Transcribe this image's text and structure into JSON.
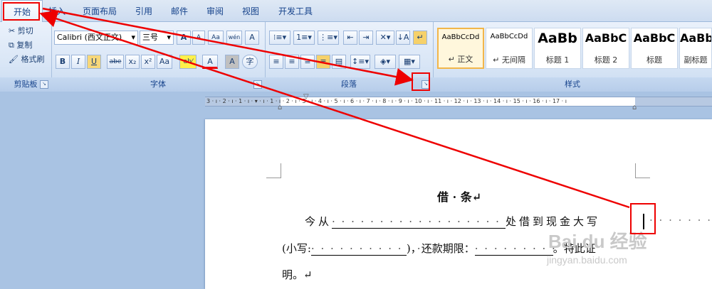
{
  "tabs": [
    "开始",
    "插入",
    "页面布局",
    "引用",
    "邮件",
    "审阅",
    "视图",
    "开发工具"
  ],
  "clipboard": {
    "cut": "剪切",
    "copy": "复制",
    "format_painter": "格式刷",
    "group_label": "剪贴板"
  },
  "font": {
    "name": "Calibri (西文正文)",
    "size": "三号",
    "grow": "A",
    "shrink": "A",
    "clear": "Aa",
    "phonetic": "wén",
    "char_border": "A",
    "bold": "B",
    "italic": "I",
    "underline": "U",
    "strike": "abe",
    "subscript": "x₂",
    "superscript": "x²",
    "case": "Aa",
    "color": "A",
    "char_shading": "A",
    "enclose": "字",
    "group_label": "字体"
  },
  "paragraph": {
    "group_label": "段落"
  },
  "styles": {
    "group_label": "样式",
    "items": [
      {
        "preview": "AaBbCcDd",
        "name": "↵ 正文"
      },
      {
        "preview": "AaBbCcDd",
        "name": "↵ 无间隔"
      },
      {
        "preview": "AaBb",
        "name": "标题 1"
      },
      {
        "preview": "AaBbC",
        "name": "标题 2"
      },
      {
        "preview": "AaBbC",
        "name": "标题"
      },
      {
        "preview": "AaBbC",
        "name": "副标题"
      }
    ]
  },
  "ruler": {
    "ticks": "3 · ı · 2 · ı · 1 · ı · ▾ · ı · 1 · ı · 2 · ı · 3 · ı · 4 · ı · 5 · ı · 6 · ı · 7 · ı · 8 · ı · 9 · ı · 10 · ı · 11 · ı · 12 · ı · 13 · ı · 14 · ı ·  15 · ı · 16 · ı · 17 · ı"
  },
  "document": {
    "title": "借  ·  条↵",
    "line1_prefix": "今从",
    "line1_blank": "· · · · · · · · · · · · · · · · · ·",
    "line1_suffix": "处借到现金大写",
    "line1_tail": "· · · · · · · · · ·",
    "line2_prefix": "(小写:",
    "line2_blank": "· · · · · · · · · · · · ·",
    "line2_mid": ")，还款期限：",
    "line2_blank2": "· · · · · · · · ·",
    "line2_suffix": "。特此证",
    "line3": "明。↵"
  },
  "watermark": {
    "brand": "Bai du 经验",
    "url": "jingyan.baidu.com"
  },
  "colors": {
    "highlight": "#e00000",
    "accent": "#15428b",
    "ribbon": "#d9e6f6"
  }
}
